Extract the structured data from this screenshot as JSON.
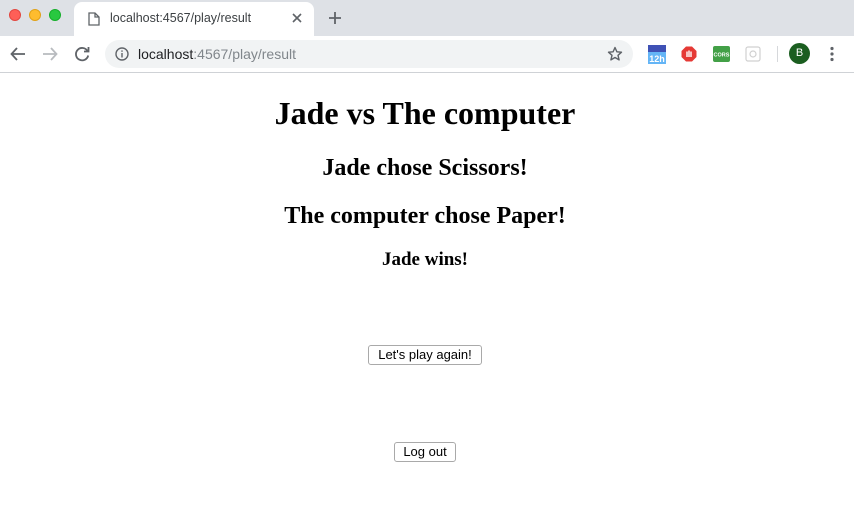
{
  "browser": {
    "tab_title": "localhost:4567/play/result",
    "url_host": "localhost",
    "url_rest": ":4567/play/result",
    "extensions": [
      {
        "name": "calendar-12h-extension",
        "label": "12h",
        "color": "#3b82f6"
      },
      {
        "name": "adblock-extension",
        "color": "#e53935"
      },
      {
        "name": "cors-extension",
        "label": "CORS",
        "color": "#43a047"
      },
      {
        "name": "puzzle-extension",
        "color": "#cfcfcf"
      }
    ],
    "profile_initial": "B"
  },
  "page": {
    "heading": "Jade vs The computer",
    "player_choice": "Jade chose Scissors!",
    "computer_choice": "The computer chose Paper!",
    "result": "Jade wins!",
    "play_again_label": "Let's play again!",
    "logout_label": "Log out"
  }
}
